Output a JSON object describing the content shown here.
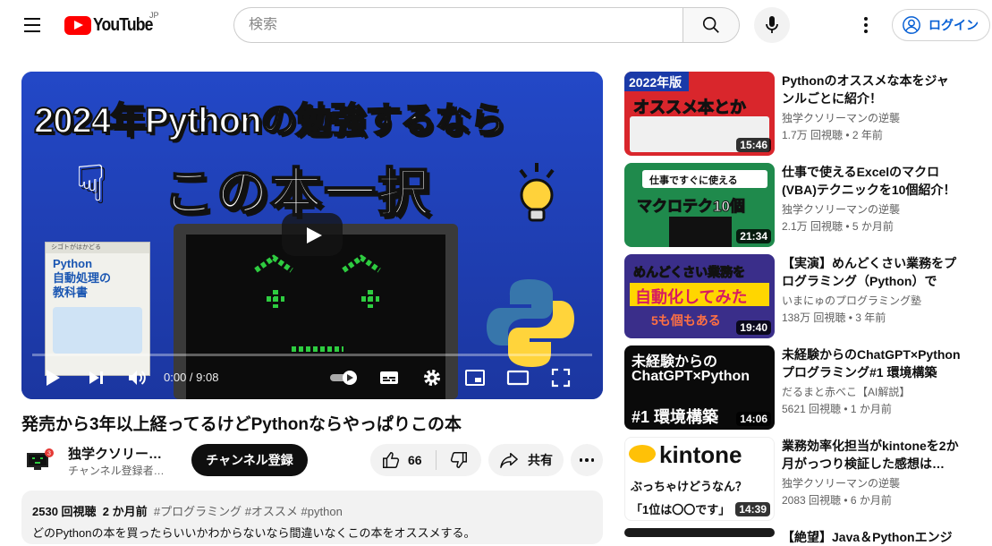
{
  "header": {
    "logo_text": "YouTube",
    "logo_region": "JP",
    "search_placeholder": "検索",
    "login_label": "ログイン"
  },
  "player": {
    "thumb_line1": "2024年Pythonの勉強するなら",
    "thumb_line2": "この本一択",
    "book_title": "Python\n自動処理の\n教科書",
    "time": "0:00 / 9:08",
    "progress": 0
  },
  "video": {
    "title": "発売から3年以上経ってるけどPythonならやっぱりこの本",
    "channel_name": "独学クソリー…",
    "channel_sub": "チャンネル登録者…",
    "subscribe_label": "チャンネル登録",
    "likes": "66",
    "share_label": "共有",
    "views": "2530 回視聴",
    "age": "2 か月前",
    "tags": "#プログラミング #オススメ #python",
    "description": "どのPythonの本を買ったらいいかわからないなら間違いなくこの本をオススメする。"
  },
  "sidebar": [
    {
      "title": "Pythonのオススメな本をジャンルごとに紹介！",
      "channel": "独学クソリーマンの逆襲",
      "meta": "1.7万 回視聴 • 2 年前",
      "duration": "15:46",
      "thumb_text": "2022年版 Python オススメ本とか",
      "bg": "#d9262c"
    },
    {
      "title": "仕事で使えるExcelのマクロ(VBA)テクニックを10個紹介！",
      "channel": "独学クソリーマンの逆襲",
      "meta": "2.1万 回視聴 • 5 か月前",
      "duration": "21:34",
      "thumb_text": "仕事ですぐに使える マクロテク10個",
      "bg": "#1f8a4c"
    },
    {
      "title": "【実演】めんどくさい業務をプログラミング（Python）で自…",
      "channel": "いまにゅのプログラミング塾",
      "meta": "138万 回視聴 • 3 年前",
      "duration": "19:40",
      "thumb_text": "めんどくさい業務を 自動化してみた",
      "bg": "#3a2e8a"
    },
    {
      "title": "未経験からのChatGPT×Pythonプログラミング#1 環境構築と…",
      "channel": "だるまと赤べこ【AI解説】",
      "meta": "5621 回視聴 • 1 か月前",
      "duration": "14:06",
      "thumb_text": "未経験からの ChatGPT×Python #1 環境構築",
      "bg": "#0a0a0a"
    },
    {
      "title": "業務効率化担当がkintoneを2か月がっつり検証した感想は…",
      "channel": "独学クソリーマンの逆襲",
      "meta": "2083 回視聴 • 6 か月前",
      "duration": "14:39",
      "thumb_text": "kintone ぶっちゃけどうなん？",
      "bg": "#ffffff"
    },
    {
      "title": "【絶望】Java＆Pythonエンジニ…",
      "channel": "",
      "meta": "",
      "duration": "",
      "thumb_text": "",
      "bg": "#1a1a1a"
    }
  ]
}
